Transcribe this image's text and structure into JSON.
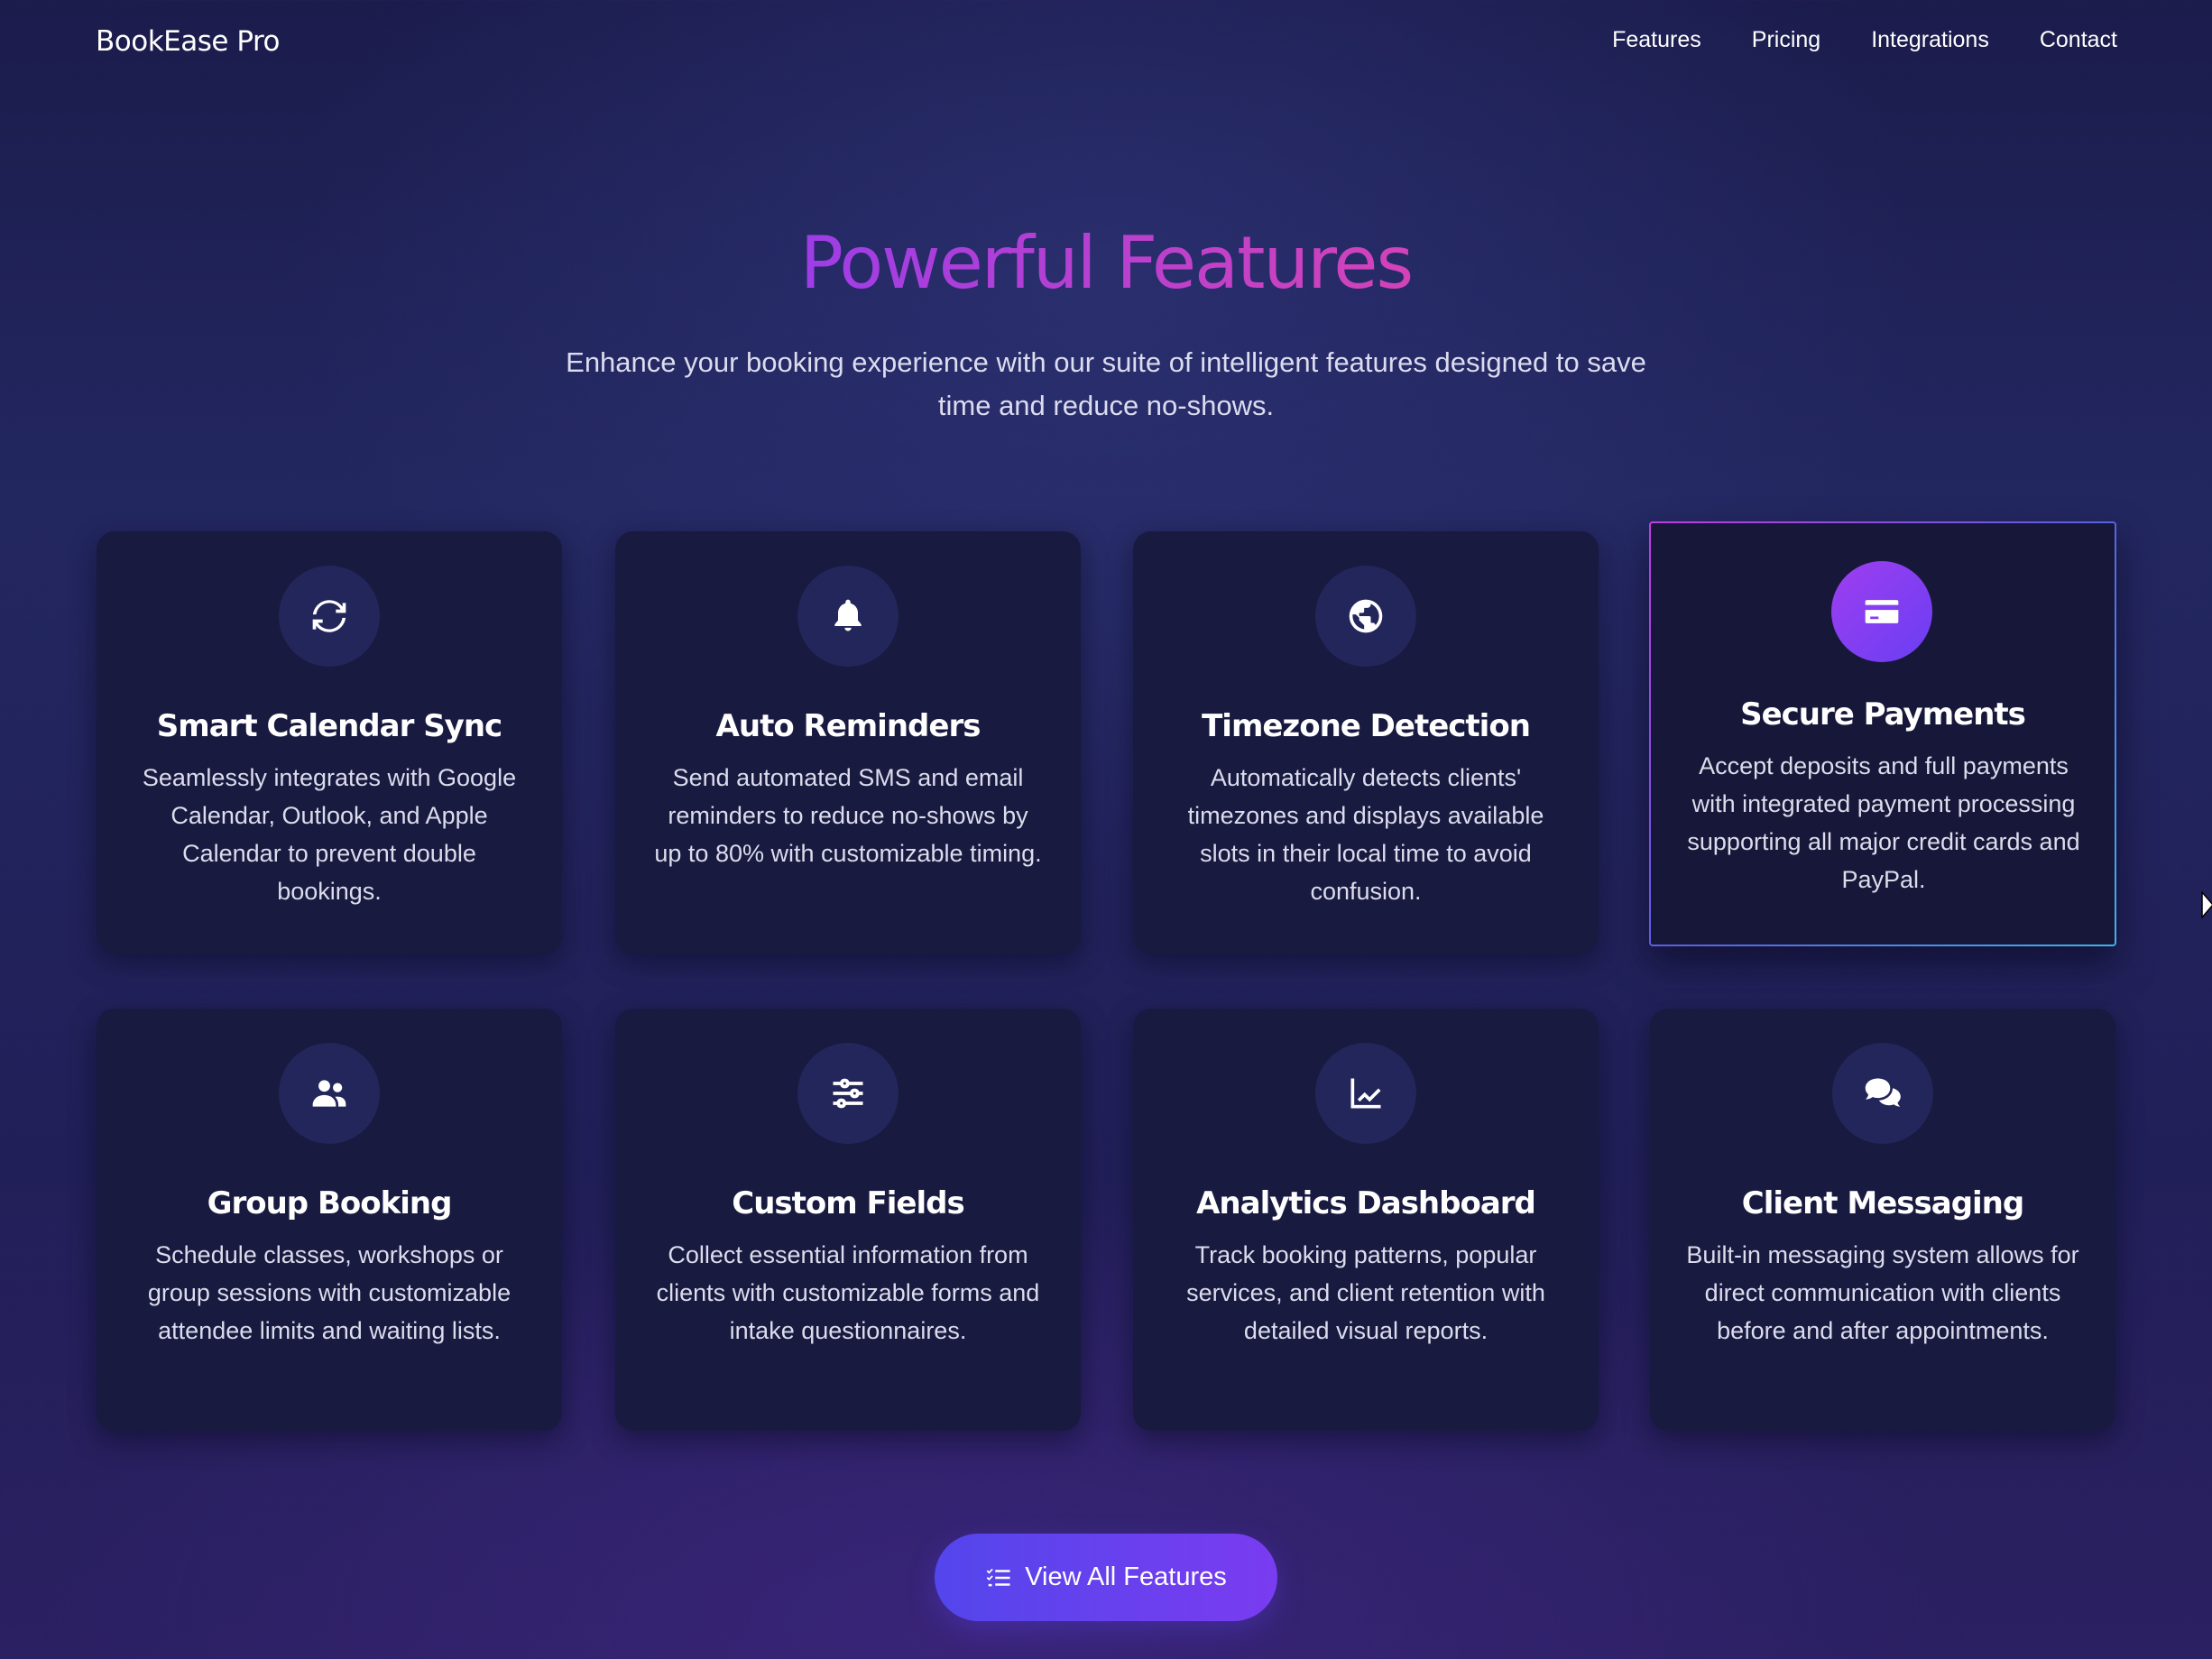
{
  "brand": "BookEase Pro",
  "nav": {
    "items": [
      "Features",
      "Pricing",
      "Integrations",
      "Contact"
    ]
  },
  "hero": {
    "title": "Powerful Features",
    "subtitle": "Enhance your booking experience with our suite of intelligent features designed to save time and reduce no-shows."
  },
  "features": [
    {
      "icon": "sync-icon",
      "title": "Smart Calendar Sync",
      "description": "Seamlessly integrates with Google Calendar, Outlook, and Apple Calendar to prevent double bookings."
    },
    {
      "icon": "bell-icon",
      "title": "Auto Reminders",
      "description": "Send automated SMS and email reminders to reduce no-shows by up to 80% with customizable timing."
    },
    {
      "icon": "globe-icon",
      "title": "Timezone Detection",
      "description": "Automatically detects clients' timezones and displays available slots in their local time to avoid confusion."
    },
    {
      "icon": "credit-card-icon",
      "title": "Secure Payments",
      "description": "Accept deposits and full payments with integrated payment processing supporting all major credit cards and PayPal.",
      "highlighted": true
    },
    {
      "icon": "users-icon",
      "title": "Group Booking",
      "description": "Schedule classes, workshops or group sessions with customizable attendee limits and waiting lists."
    },
    {
      "icon": "sliders-icon",
      "title": "Custom Fields",
      "description": "Collect essential information from clients with customizable forms and intake questionnaires."
    },
    {
      "icon": "chart-line-icon",
      "title": "Analytics Dashboard",
      "description": "Track booking patterns, popular services, and client retention with detailed visual reports."
    },
    {
      "icon": "comments-icon",
      "title": "Client Messaging",
      "description": "Built-in messaging system allows for direct communication with clients before and after appointments."
    }
  ],
  "cta": {
    "label": "View All Features",
    "icon": "list-check-icon"
  },
  "colors": {
    "background": "#1f2256",
    "card": "#181a40",
    "title_gradient_start": "#9b3de9",
    "title_gradient_end": "#d543b6",
    "button_start": "#5346ec",
    "button_end": "#7a3cf0"
  }
}
